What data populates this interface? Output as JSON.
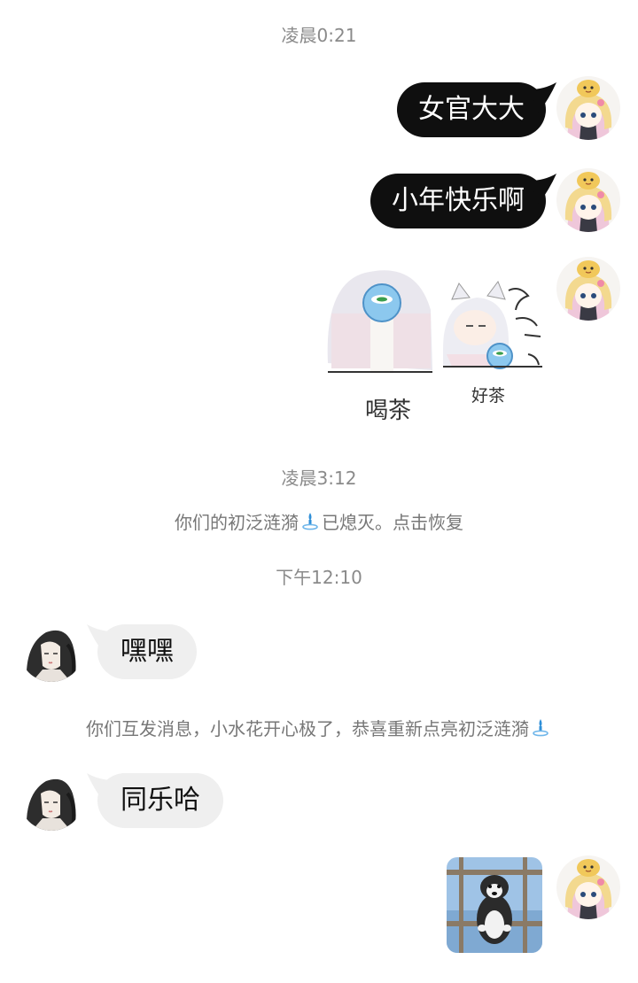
{
  "timestamps": {
    "t1": "凌晨0:21",
    "t2": "凌晨3:12",
    "t3": "下午12:10"
  },
  "system": {
    "streak_lost": "你们的初泛涟漪",
    "streak_lost_suffix": "已熄灭。点击恢复",
    "streak_restored": "你们互发消息，小水花开心极了，恭喜重新点亮初泛涟漪"
  },
  "messages": {
    "out1": "女官大大",
    "out2": "小年快乐啊",
    "in1": "嘿嘿",
    "in2": "同乐哈"
  },
  "sticker": {
    "label_left": "喝茶",
    "label_right": "好茶"
  },
  "colors": {
    "outgoing_bubble": "#0f0f0f",
    "incoming_bubble": "#efefef",
    "timestamp": "#8a8a8a",
    "ripple_icon": "#2f8fd8"
  },
  "icons": {
    "ripple": "ripple-icon",
    "self_avatar": "chibi-girl-avatar",
    "other_avatar": "ink-portrait-avatar"
  }
}
